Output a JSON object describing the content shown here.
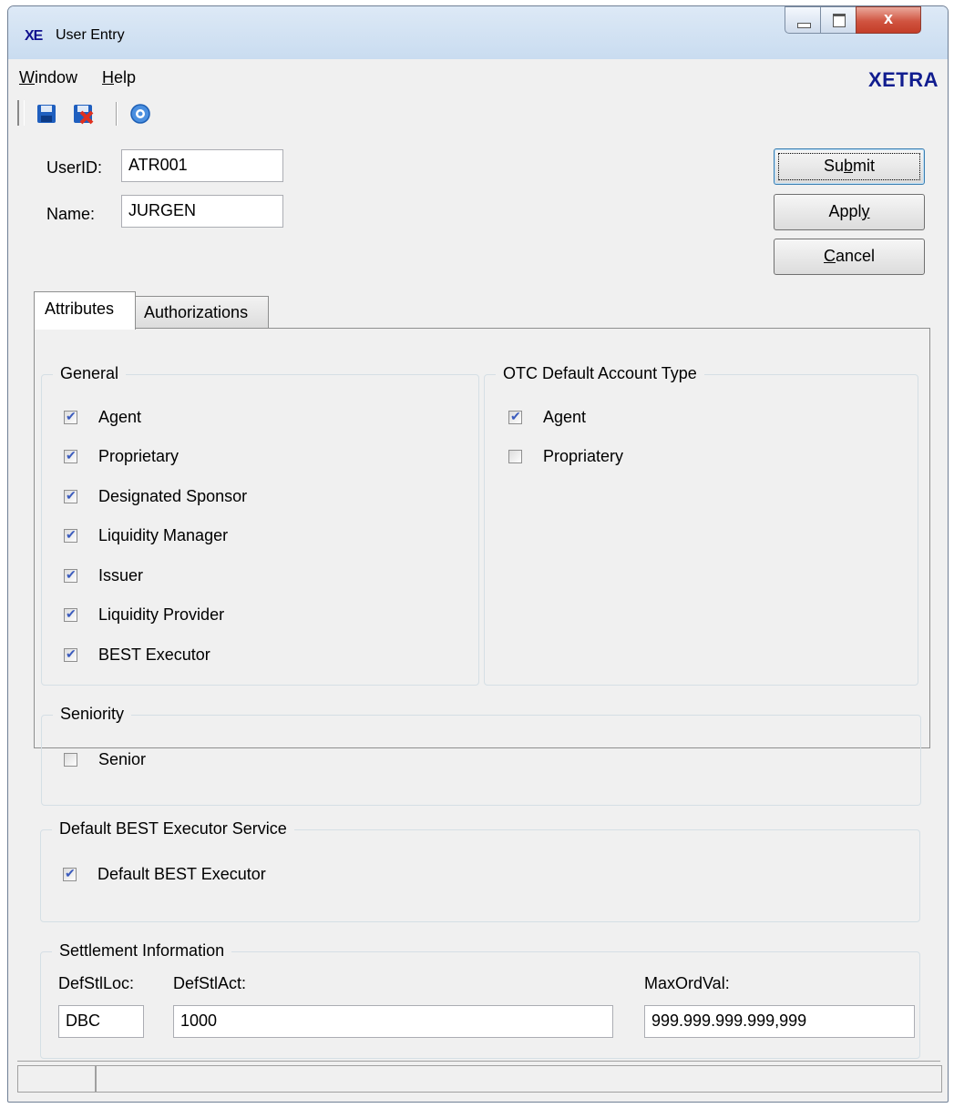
{
  "window": {
    "logo": "XE",
    "title": "User Entry",
    "close_glyph": "x",
    "buttons": [
      "minimize-icon",
      "maximize-icon",
      "close-icon"
    ]
  },
  "menu": {
    "window_label_first": "W",
    "window_label_rest": "indow",
    "help_label_first": "H",
    "help_label_rest": "elp",
    "brand": "XETRA"
  },
  "toolbar": {
    "icons": [
      "save-icon",
      "save-close-icon",
      "help-icon"
    ]
  },
  "form": {
    "userid_label": "UserID:",
    "userid_value": "ATR001",
    "name_label": "Name:",
    "name_value": "JURGEN"
  },
  "actions": {
    "submit_pre": "Su",
    "submit_ul": "b",
    "submit_post": "mit",
    "apply_pre": "Appl",
    "apply_ul": "y",
    "apply_post": "",
    "cancel_pre": "",
    "cancel_ul": "C",
    "cancel_post": "ancel"
  },
  "tabs": {
    "attributes": "Attributes",
    "authorizations": "Authorizations"
  },
  "general": {
    "title": "General",
    "items": [
      {
        "label": "Agent",
        "checked": true
      },
      {
        "label": "Proprietary",
        "checked": true
      },
      {
        "label": "Designated Sponsor",
        "checked": true
      },
      {
        "label": "Liquidity Manager",
        "checked": true
      },
      {
        "label": "Issuer",
        "checked": true
      },
      {
        "label": "Liquidity Provider",
        "checked": true
      },
      {
        "label": "BEST Executor",
        "checked": true
      }
    ]
  },
  "otc": {
    "title": "OTC Default Account Type",
    "items": [
      {
        "label": "Agent",
        "checked": true
      },
      {
        "label": "Propriatery",
        "checked": false
      }
    ]
  },
  "seniority": {
    "title": "Seniority",
    "items": [
      {
        "label": "Senior",
        "checked": false
      }
    ]
  },
  "best_service": {
    "title": "Default BEST Executor Service",
    "items": [
      {
        "label": "Default BEST Executor",
        "checked": true
      }
    ]
  },
  "settlement": {
    "title": "Settlement Information",
    "defstlloc_label": "DefStlLoc:",
    "defstlloc_value": "DBC",
    "defstlact_label": "DefStlAct:",
    "defstlact_value": "1000",
    "maxordval_label": "MaxOrdVal:",
    "maxordval_value": "999.999.999.999,999"
  }
}
